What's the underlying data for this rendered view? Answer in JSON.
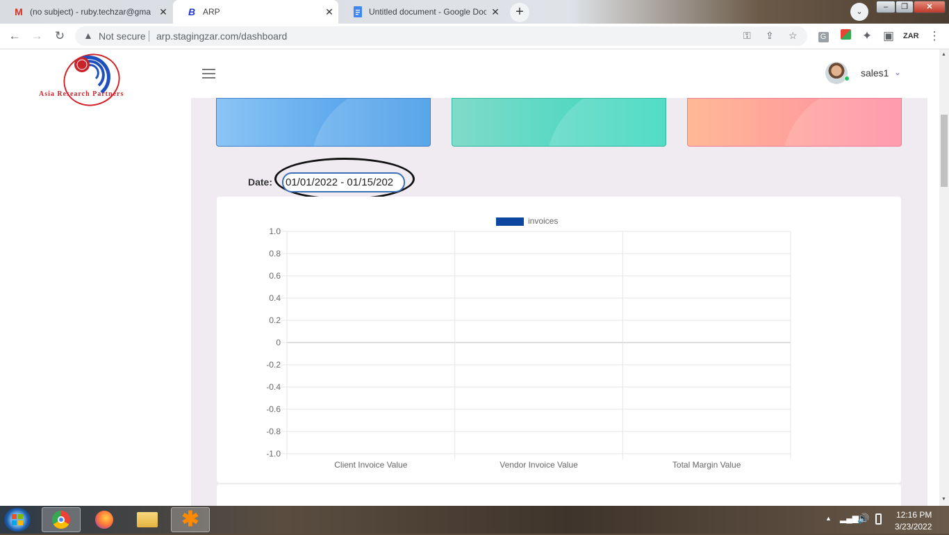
{
  "tabs": [
    {
      "title": "(no subject) - ruby.techzar@gma",
      "favicon": "gmail-icon",
      "active": false
    },
    {
      "title": "ARP",
      "favicon": "arp-icon",
      "active": true
    },
    {
      "title": "Untitled document - Google Doc",
      "favicon": "docs-icon",
      "active": false
    }
  ],
  "omnibox": {
    "security": "Not secure",
    "url": "arp.stagingzar.com/dashboard"
  },
  "header": {
    "username": "sales1"
  },
  "logo": {
    "text": "Asia Research Partners"
  },
  "filter": {
    "date_label": "Date:",
    "date_value": "01/01/2022 - 01/15/202"
  },
  "colors": {
    "bar_series": "#0d47a1",
    "card1": "#4da3ec",
    "card2": "#5ad8c3",
    "card3": "#ff9aa0"
  },
  "chart_data": {
    "type": "bar",
    "categories": [
      "Client Invoice Value",
      "Vendor Invoice Value",
      "Total Margin Value"
    ],
    "series": [
      {
        "name": "invoices",
        "values": [
          0,
          0,
          0
        ]
      }
    ],
    "title": "",
    "xlabel": "",
    "ylabel": "",
    "ylim": [
      -1.0,
      1.0
    ],
    "yticks": [
      "1.0",
      "0.8",
      "0.6",
      "0.4",
      "0.2",
      "0",
      "-0.2",
      "-0.4",
      "-0.6",
      "-0.8",
      "-1.0"
    ],
    "legend": "top-center",
    "grid": true
  },
  "taskbar": {
    "time": "12:16 PM",
    "date": "3/23/2022"
  }
}
